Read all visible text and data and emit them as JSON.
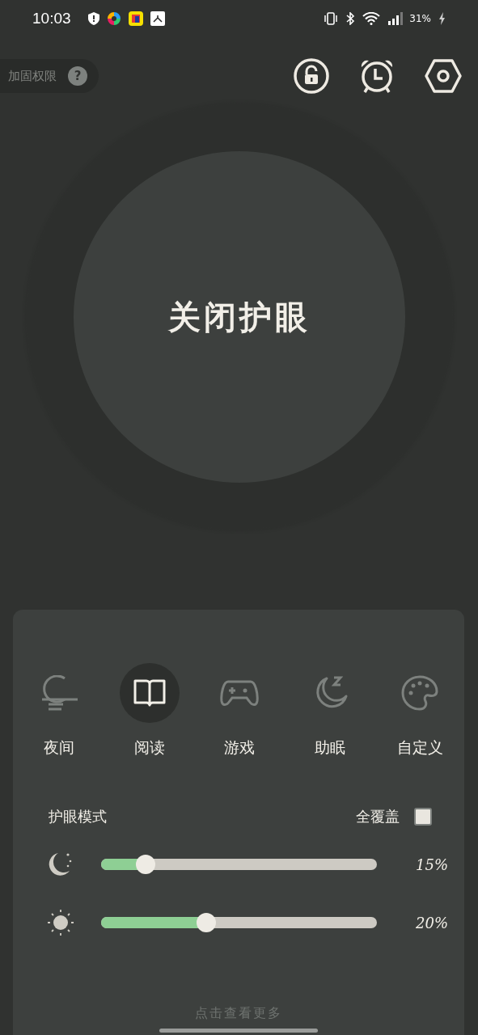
{
  "status_bar": {
    "time": "10:03",
    "battery": "31%"
  },
  "permission_badge": {
    "label": "加固权限",
    "help": "?"
  },
  "main_button": {
    "label": "关闭护眼"
  },
  "modes": [
    {
      "label": "夜间",
      "kind": "night",
      "selected": false
    },
    {
      "label": "阅读",
      "kind": "reading",
      "selected": true
    },
    {
      "label": "游戏",
      "kind": "game",
      "selected": false
    },
    {
      "label": "助眠",
      "kind": "sleep",
      "selected": false
    },
    {
      "label": "自定义",
      "kind": "custom",
      "selected": false
    }
  ],
  "mode_title": "护眼模式",
  "full_cover": {
    "label": "全覆盖",
    "checked": false
  },
  "sliders": [
    {
      "kind": "moon",
      "level": 0.16,
      "reading": "15%"
    },
    {
      "kind": "sun",
      "level": 0.38,
      "reading": "20%"
    }
  ],
  "more_link": "点击查看更多"
}
